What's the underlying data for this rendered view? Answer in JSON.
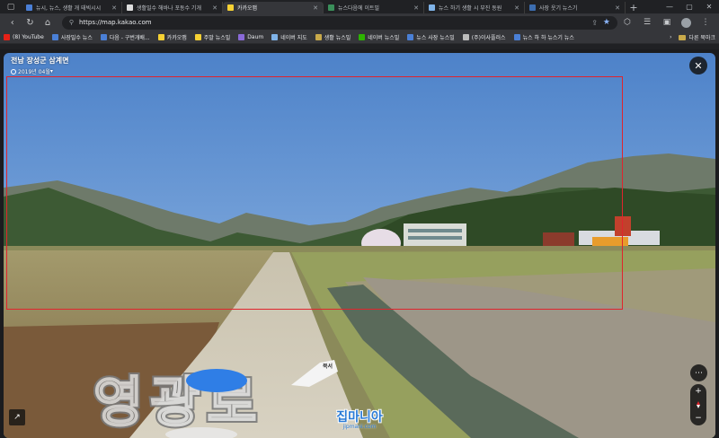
{
  "browser": {
    "tabs": [
      {
        "title": "뉴시, 뉴스, 생활 개 태빅시시",
        "color": "#4a7fd6",
        "active": false
      },
      {
        "title": "생활밀수 해바나 포동수 기개",
        "color": "#dddddd",
        "active": false
      },
      {
        "title": "카카오맵",
        "color": "#f6d133",
        "active": true
      },
      {
        "title": "뉴스다음에 이트밀",
        "color": "#3a8f5a",
        "active": false
      },
      {
        "title": "뉴스 하기 생활 시 부진 동원",
        "color": "#7fb3e8",
        "active": false
      },
      {
        "title": "사장 웃기 뉴스기",
        "color": "#3c6db0",
        "active": false
      }
    ],
    "new_tab_label": "+",
    "url": "https://map.kakao.com",
    "bookmarks": [
      {
        "label": "(8) YouTube",
        "color": "#e62117"
      },
      {
        "label": "사장밀수 뉴스",
        "color": "#4a7fd6"
      },
      {
        "label": "다음 - 구번개배...",
        "color": "#4a7fd6"
      },
      {
        "label": "카카오맵",
        "color": "#f6d133"
      },
      {
        "label": "주말 뉴스밀",
        "color": "#f6d133"
      },
      {
        "label": "Daum",
        "color": "#8a6ad8"
      },
      {
        "label": "네이버 지도",
        "color": "#7fb3e8"
      },
      {
        "label": "생활 뉴스밀",
        "color": "#c8a94a"
      },
      {
        "label": "네이버 뉴스밀",
        "color": "#2db400"
      },
      {
        "label": "뉴스 사장 뉴스밀",
        "color": "#4a7fd6"
      },
      {
        "label": "(주)이사플러스",
        "color": "#bbbbbb"
      },
      {
        "label": "뉴스 하 하 뉴스기 뉴스",
        "color": "#4a7fd6"
      }
    ],
    "bookmarks_folder": "다른 북마크"
  },
  "roadview": {
    "place_name": "전남 장성군 삼계면",
    "capture_date": "2019년 04월",
    "direction_label": "북서",
    "road_text": "영광로",
    "close_icon": "✕",
    "more_icon": "⋯",
    "zoom_in": "+",
    "zoom_out": "−",
    "expand_icon": "↗"
  },
  "watermark": {
    "main": "집마니아",
    "sub": "jipmani.com"
  },
  "colors": {
    "highlight": "#e0242d",
    "sky": "#5d8fd0",
    "accent": "#8ab4f8"
  }
}
